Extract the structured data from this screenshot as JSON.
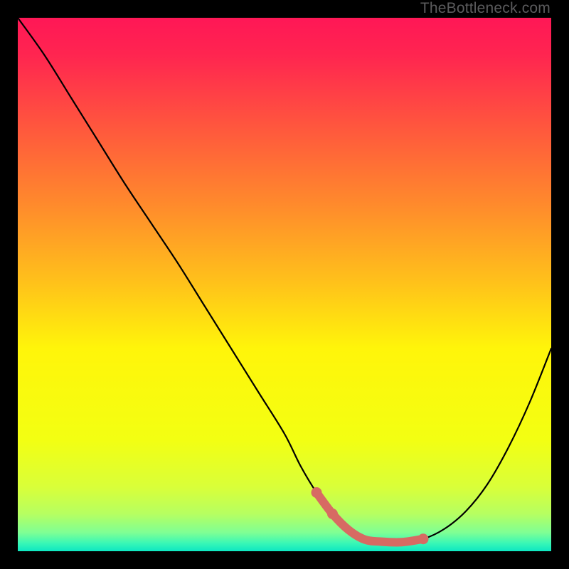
{
  "watermark": {
    "text": "TheBottleneck.com"
  },
  "colors": {
    "background": "#000000",
    "gradient_stops": [
      {
        "offset": 0.0,
        "color": "#ff1756"
      },
      {
        "offset": 0.07,
        "color": "#ff2550"
      },
      {
        "offset": 0.2,
        "color": "#ff553e"
      },
      {
        "offset": 0.35,
        "color": "#ff8a2c"
      },
      {
        "offset": 0.5,
        "color": "#ffc31a"
      },
      {
        "offset": 0.62,
        "color": "#fff50a"
      },
      {
        "offset": 0.79,
        "color": "#f3ff12"
      },
      {
        "offset": 0.88,
        "color": "#d9ff39"
      },
      {
        "offset": 0.93,
        "color": "#b6ff61"
      },
      {
        "offset": 0.965,
        "color": "#7fff94"
      },
      {
        "offset": 0.985,
        "color": "#39f7b6"
      },
      {
        "offset": 1.0,
        "color": "#0de7c2"
      }
    ],
    "curve": "#000000",
    "overlay": "#d76a63"
  },
  "chart_data": {
    "type": "line",
    "title": "",
    "xlabel": "",
    "ylabel": "",
    "x": [
      0,
      5,
      10,
      15,
      20,
      25,
      30,
      35,
      40,
      45,
      50,
      53,
      56,
      59,
      62,
      65,
      68,
      72,
      76,
      80,
      84,
      88,
      92,
      96,
      100
    ],
    "series": [
      {
        "name": "bottleneck-curve",
        "values": [
          100,
          93,
          85,
          77,
          69,
          61.5,
          54,
          46,
          38,
          30,
          22,
          16,
          11,
          7,
          4,
          2.2,
          1.8,
          1.7,
          2.3,
          4.2,
          7.5,
          12.5,
          19.5,
          28,
          38
        ]
      }
    ],
    "overlay_segment": {
      "name": "highlighted-range",
      "x_range": [
        56,
        76
      ],
      "values_along_curve": true
    },
    "overlay_dots": [
      {
        "x": 56,
        "y": 11
      },
      {
        "x": 59,
        "y": 7
      },
      {
        "x": 76,
        "y": 2.3
      }
    ],
    "xlim": [
      0,
      100
    ],
    "ylim": [
      0,
      100
    ]
  }
}
